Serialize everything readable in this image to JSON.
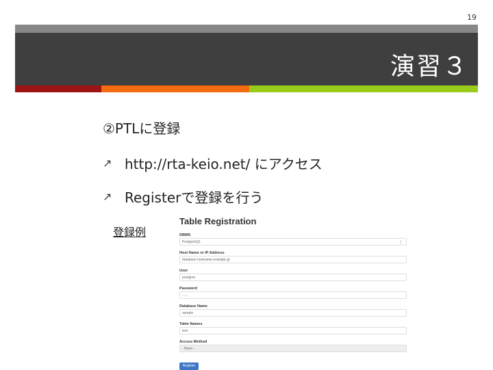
{
  "page_number": "19",
  "slide_title": "演習３",
  "heading": "②PTLに登録",
  "bullets": [
    {
      "text": "http://rta-keio.net/ にアクセス"
    },
    {
      "text": "Registerで登録を行う"
    }
  ],
  "example_label": "登録例",
  "form": {
    "title": "Table Registration",
    "fields": [
      {
        "label": "DBMS",
        "value": "PostgreSQL"
      },
      {
        "label": "Host Name or IP Address",
        "value": "database.hostname.example.jp"
      },
      {
        "label": "User",
        "value": "postgres"
      },
      {
        "label": "Password",
        "value": "......"
      },
      {
        "label": "Database Name",
        "value": "sample"
      },
      {
        "label": "Table Names",
        "value": "test"
      },
      {
        "label": "Access Method",
        "value": "- None -"
      }
    ],
    "submit_label": "Register"
  },
  "colors": {
    "title_band": "#3f3f3f",
    "top_bar": "#878787",
    "accent_red": "#9e1414",
    "accent_orange": "#f26b0f",
    "accent_green": "#99cc1a",
    "button": "#3b77c4"
  }
}
